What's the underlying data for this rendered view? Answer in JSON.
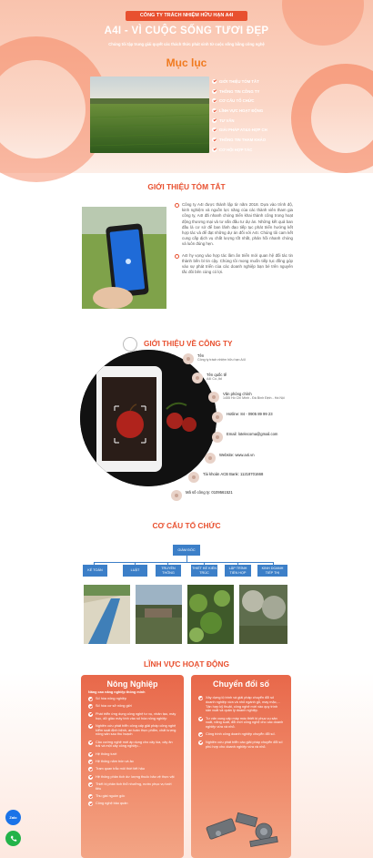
{
  "header": {
    "company": "CÔNG TY TRÁCH NHIỆM HỮU HẠN A4I",
    "title": "A4I - VÌ CUỘC SỐNG TƯƠI ĐẸP",
    "subtitle": "Chúng tôi tập trung giải quyết các thách thức phát sinh từ cuộc sống bằng công nghệ"
  },
  "toc": {
    "title": "Mục lục",
    "items": [
      "GIỚI THIỆU TÓM TẮT",
      "THÔNG TIN CÔNG TY",
      "CƠ CẤU TỔ CHỨC",
      "LĨNH VỰC HOẠT ĐỘNG",
      "TƯ VẤN",
      "GIẢI PHÁP AT&X-HỢP CH",
      "THÔNG TIN THAM KHẢO",
      "CƠ HỘI HỢP TÁC"
    ]
  },
  "intro": {
    "title": "GIỚI THIỆU TÓM TẮT",
    "p1": "Công ty A4I được thành lập từ năm 2018. Dựa vào trình độ, kinh nghiệm và nguồn lực năng của các thành viên tham gia công ty, A4I đã nhanh chóng triển khai thành công trong hoạt động thương mại và tư vấn đầu tư dự án. Những kết quả ban đầu là cơ sở để ban lãnh đạo tiếp tục phát triển hướng kết hợp tác và để đạt những dự án đối với A4I. Chúng tôi cam kết cung cấp dịch vụ chất lượng tốt nhất, phản hồi nhanh chóng và luôn đúng hẹn.",
    "p2": "A4I hy vọng vào hợp tác lâm ân triển mới quan hệ đối tác tin thành bền bỉ tin cậy. Chúng tôi mong muốn tiếp tục đồng góp vào sự phát triển của các doanh nghiệp bạn bè trên nguyên tắc đôi bên cùng có lợi."
  },
  "about": {
    "title": "GIỚI THIỆU VỀ CÔNG TY",
    "items": [
      {
        "label": "Tên",
        "value": "Công ty trách nhiệm hữu hạn A4I"
      },
      {
        "label": "Tên quốc tế",
        "value": "A4I Co.,ltd"
      },
      {
        "label": "Văn phòng chính",
        "value": "1455 Hồ Chí Minh - Đà Bình Định - Hà Nội"
      },
      {
        "label": "Hotline: 84 - 0905 89 99 23",
        "value": ""
      },
      {
        "label": "Email: lotelecoma@gmail.com",
        "value": ""
      },
      {
        "label": "Website: www.a4i.vn",
        "value": ""
      },
      {
        "label": "Tài khoản ACB Bank: 11218701668",
        "value": ""
      },
      {
        "label": "Mã số công ty: 0109561521",
        "value": ""
      }
    ]
  },
  "org": {
    "title": "CƠ CẤU TỔ CHỨC",
    "top": "GIÁM ĐỐC",
    "depts": [
      "KẾ TOÁN",
      "LUẬT",
      "TRUYỀN THÔNG",
      "THIẾT KẾ KIẾN TRÚC",
      "LẬP TRÌNH TIỂN HỌP",
      "KINH DOANH TIẾP THỊ"
    ]
  },
  "activities": {
    "title": "LĨNH VỰC HOẠT ĐỘNG",
    "agri": {
      "title": "Nông Nghiệp",
      "caption": "Nâng cao năng nghiệp thông minh",
      "items": [
        "Số hóa nông nghiệp",
        "Số hóa cơ sở nông giới",
        "Phát triển ứng dụng công nghệ tư vụ, nhân tạo, máy học, dữ giảo máy tính vào số hóa nông nghiệp",
        "Nghiên cứu phát triển công cấp giải pháp công nghệ kiểm soát định bệnh, an toàn thực phẩm, chất lượng nông sản sau thu hoạch",
        "Cảo cường nghệ mới áp dụng cho cây lúa, cây ăn trái và một cây công nghiệp...",
        "Hệ thống tưới",
        "Hệ thống năm tròn và ảo",
        "Trạm quan trắc môi thời tiết hậu",
        "Hệ thống phân tích dư lượng thuốc bảo vệ thực vật",
        "Thiết bị phân tích thổ nhưỡng, nước phục vụ tưới tiêu",
        "Thu giai nguồn gốc",
        "Công nghệ bảo quản"
      ]
    },
    "digital": {
      "title": "Chuyển đổi số",
      "items": [
        "Xây dựng lộ trình và giải pháp chuyển đổi số doanh nghiệp vừa và nhỏ ngành gỗ, may mặc,... Tận hợp kỹ thuật, công nghệ mới vào quy trình sản xuất và quản lý doanh nghiệp.",
        "Tư vấn cung cấp máy móc thiết bị phục vụ sản xuất, năng suất, đổi mới công nghệ cho các doanh nghiệp vừa và nhỏ.",
        "Công trình công doanh nghiệp chuyển đổi số.",
        "Nghiên cứu phát triển các giải pháp chuyển đổi số phù hợp cho doanh nghiệp vừa và nhỏ."
      ]
    }
  },
  "floating": {
    "zalo": "Zalo"
  }
}
